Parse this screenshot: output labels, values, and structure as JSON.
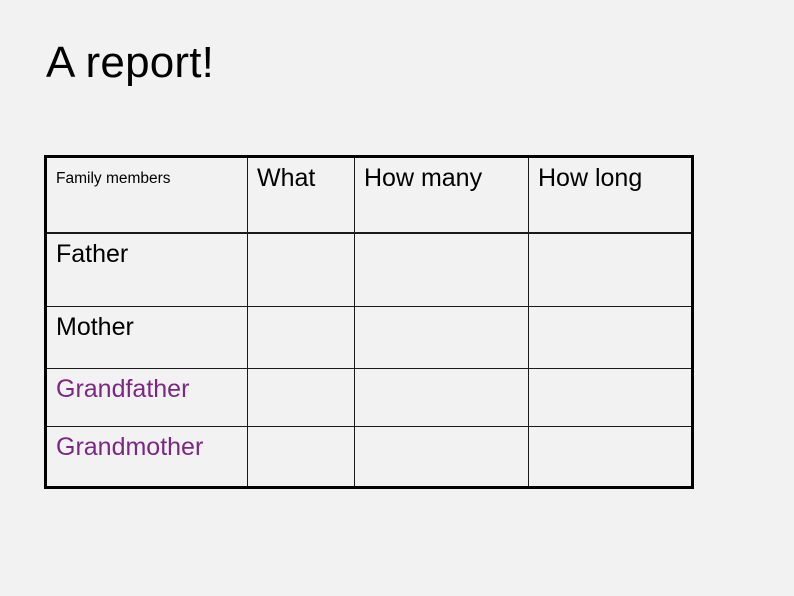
{
  "slide": {
    "title": "A report!",
    "background_color": "#f2f2f2",
    "title_color": "#000000",
    "accent_color": "#7b2882",
    "border_color": "#000000"
  },
  "table": {
    "headers": [
      {
        "label": "Family members",
        "style": "small"
      },
      {
        "label": "What",
        "style": "large"
      },
      {
        "label": "How many",
        "style": "large"
      },
      {
        "label": "How long",
        "style": "large"
      }
    ],
    "rows": [
      {
        "member": "Father",
        "color": "#000000",
        "what": "",
        "how_many": "",
        "how_long": ""
      },
      {
        "member": "Mother",
        "color": "#000000",
        "what": "",
        "how_many": "",
        "how_long": ""
      },
      {
        "member": "Grandfather",
        "color": "#7b2882",
        "what": "",
        "how_many": "",
        "how_long": ""
      },
      {
        "member": "Grandmother",
        "color": "#7b2882",
        "what": "",
        "how_many": "",
        "how_long": ""
      }
    ]
  }
}
